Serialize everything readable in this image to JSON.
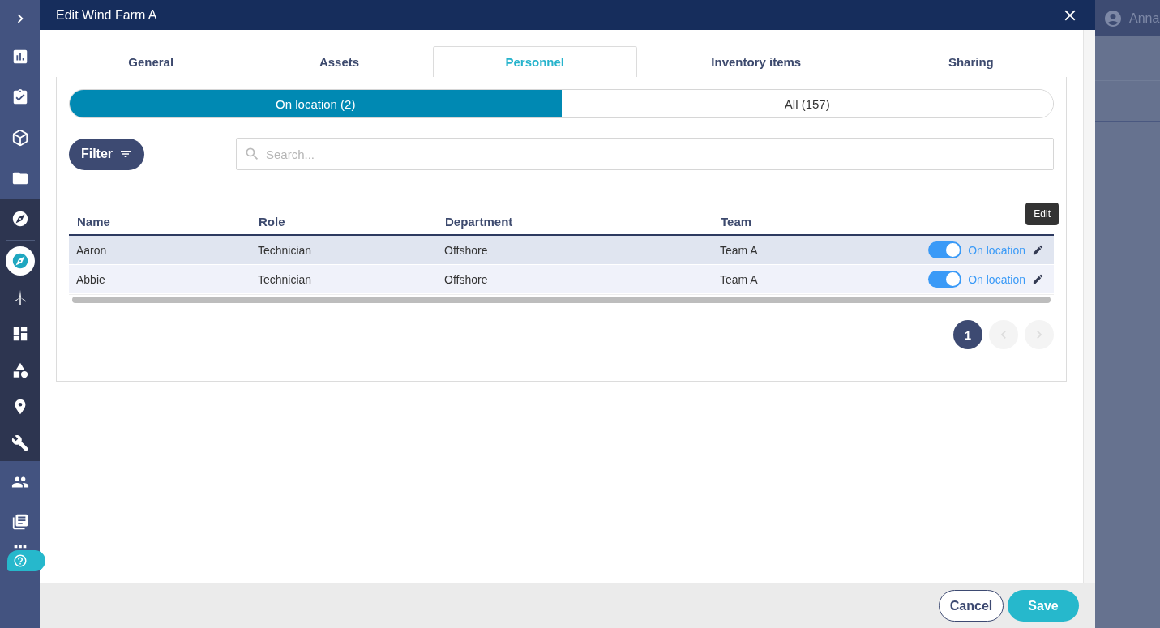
{
  "sidebar": {
    "items": [
      {
        "selected": false
      },
      {
        "selected": false
      },
      {
        "selected": false
      },
      {
        "selected": false
      },
      {
        "selected": false
      },
      {
        "selected": false
      },
      {
        "selected": true
      },
      {
        "selected": false
      },
      {
        "selected": false
      },
      {
        "selected": false
      },
      {
        "selected": false
      },
      {
        "selected": false
      },
      {
        "selected": false
      },
      {
        "selected": false
      }
    ]
  },
  "user": {
    "name": "Anna"
  },
  "dialog": {
    "title": "Edit Wind Farm A",
    "tabs": [
      {
        "label": "General",
        "selected": false
      },
      {
        "label": "Assets",
        "selected": false
      },
      {
        "label": "Personnel",
        "selected": true
      },
      {
        "label": "Inventory items",
        "selected": false
      },
      {
        "label": "Sharing",
        "selected": false
      }
    ],
    "segments": [
      {
        "label": "On location (2)",
        "selected": true
      },
      {
        "label": "All (157)",
        "selected": false
      }
    ],
    "filter_button": "Filter",
    "search": {
      "placeholder": "Search..."
    },
    "table": {
      "columns": [
        "Name",
        "Role",
        "Department",
        "Team"
      ],
      "rows": [
        {
          "cells": [
            "Aaron",
            "Technician",
            "Offshore",
            "Team A"
          ],
          "on": true,
          "status": "On location"
        },
        {
          "cells": [
            "Abbie",
            "Technician",
            "Offshore",
            "Team A"
          ],
          "on": true,
          "status": "On location"
        }
      ]
    },
    "tooltip": "Edit",
    "pagination": {
      "pages": [
        {
          "label": "1",
          "selected": true
        }
      ],
      "prev_disabled": true,
      "next_disabled": true
    },
    "buttons": {
      "cancel": "Cancel",
      "save": "Save"
    }
  }
}
